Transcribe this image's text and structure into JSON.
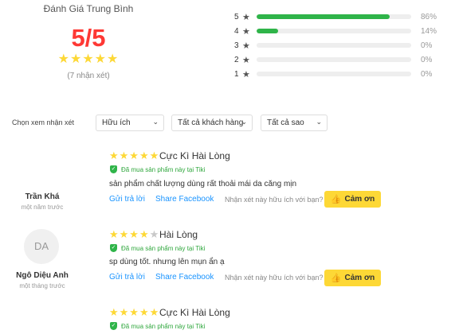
{
  "summary": {
    "title": "Đánh Giá Trung Bình",
    "score": "5/5",
    "stars": "★★★★★",
    "count": "(7 nhận xét)"
  },
  "distribution": [
    {
      "stars": "5",
      "percent_label": "86%",
      "percent": 86
    },
    {
      "stars": "4",
      "percent_label": "14%",
      "percent": 14
    },
    {
      "stars": "3",
      "percent_label": "0%",
      "percent": 0
    },
    {
      "stars": "2",
      "percent_label": "0%",
      "percent": 0
    },
    {
      "stars": "1",
      "percent_label": "0%",
      "percent": 0
    }
  ],
  "filters": {
    "label": "Chọn xem nhận xét",
    "sort": "Hữu ích",
    "customers": "Tất cả khách hàng",
    "stars": "Tất cả sao"
  },
  "reviews": [
    {
      "author": "Trần Khá",
      "time": "một năm trước",
      "rating": 5,
      "title": "Cực Kì Hài Lòng",
      "verified": "Đã mua sản phẩm này tại Tiki",
      "content": "sản phẩm chất lượng dùng rất thoải mái da căng mịn",
      "reply": "Gửi trả lời",
      "share": "Share Facebook",
      "helpful_question": "Nhận xét này hữu ích với bạn?",
      "thanks": "Cảm ơn"
    },
    {
      "author": "Ngô Diệu Anh",
      "avatar": "DA",
      "time": "một tháng trước",
      "rating": 4,
      "title": "Hài Lòng",
      "verified": "Đã mua sản phẩm này tại Tiki",
      "content": "sp dùng tốt. nhưng lên mụn ẩn ạ",
      "reply": "Gửi trả lời",
      "share": "Share Facebook",
      "helpful_question": "Nhận xét này hữu ích với bạn?",
      "thanks": "Cảm ơn"
    },
    {
      "rating": 5,
      "title": "Cực Kì Hài Lòng",
      "verified": "Đã mua sản phẩm này tại Tiki"
    }
  ],
  "icons": {
    "star": "★",
    "chevron": "⌄",
    "thumb": "👍"
  },
  "colors": {
    "score": "#fe3834",
    "star": "#fdd836",
    "bar": "#2fb449",
    "link": "#1a94ff",
    "button": "#fdd836"
  }
}
